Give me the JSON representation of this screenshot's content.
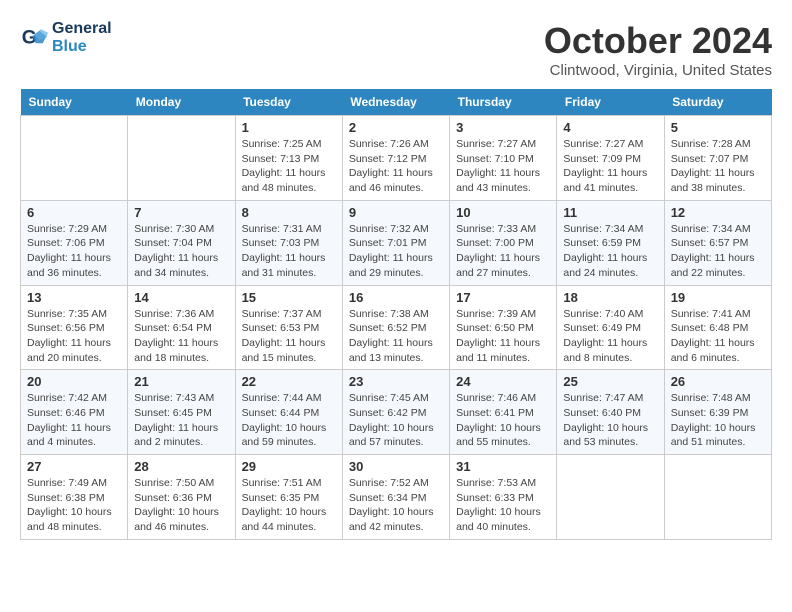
{
  "header": {
    "logo_line1": "General",
    "logo_line2": "Blue",
    "title": "October 2024",
    "subtitle": "Clintwood, Virginia, United States"
  },
  "days": [
    "Sunday",
    "Monday",
    "Tuesday",
    "Wednesday",
    "Thursday",
    "Friday",
    "Saturday"
  ],
  "weeks": [
    [
      {
        "date": "",
        "text": ""
      },
      {
        "date": "",
        "text": ""
      },
      {
        "date": "1",
        "text": "Sunrise: 7:25 AM\nSunset: 7:13 PM\nDaylight: 11 hours and 48 minutes."
      },
      {
        "date": "2",
        "text": "Sunrise: 7:26 AM\nSunset: 7:12 PM\nDaylight: 11 hours and 46 minutes."
      },
      {
        "date": "3",
        "text": "Sunrise: 7:27 AM\nSunset: 7:10 PM\nDaylight: 11 hours and 43 minutes."
      },
      {
        "date": "4",
        "text": "Sunrise: 7:27 AM\nSunset: 7:09 PM\nDaylight: 11 hours and 41 minutes."
      },
      {
        "date": "5",
        "text": "Sunrise: 7:28 AM\nSunset: 7:07 PM\nDaylight: 11 hours and 38 minutes."
      }
    ],
    [
      {
        "date": "6",
        "text": "Sunrise: 7:29 AM\nSunset: 7:06 PM\nDaylight: 11 hours and 36 minutes."
      },
      {
        "date": "7",
        "text": "Sunrise: 7:30 AM\nSunset: 7:04 PM\nDaylight: 11 hours and 34 minutes."
      },
      {
        "date": "8",
        "text": "Sunrise: 7:31 AM\nSunset: 7:03 PM\nDaylight: 11 hours and 31 minutes."
      },
      {
        "date": "9",
        "text": "Sunrise: 7:32 AM\nSunset: 7:01 PM\nDaylight: 11 hours and 29 minutes."
      },
      {
        "date": "10",
        "text": "Sunrise: 7:33 AM\nSunset: 7:00 PM\nDaylight: 11 hours and 27 minutes."
      },
      {
        "date": "11",
        "text": "Sunrise: 7:34 AM\nSunset: 6:59 PM\nDaylight: 11 hours and 24 minutes."
      },
      {
        "date": "12",
        "text": "Sunrise: 7:34 AM\nSunset: 6:57 PM\nDaylight: 11 hours and 22 minutes."
      }
    ],
    [
      {
        "date": "13",
        "text": "Sunrise: 7:35 AM\nSunset: 6:56 PM\nDaylight: 11 hours and 20 minutes."
      },
      {
        "date": "14",
        "text": "Sunrise: 7:36 AM\nSunset: 6:54 PM\nDaylight: 11 hours and 18 minutes."
      },
      {
        "date": "15",
        "text": "Sunrise: 7:37 AM\nSunset: 6:53 PM\nDaylight: 11 hours and 15 minutes."
      },
      {
        "date": "16",
        "text": "Sunrise: 7:38 AM\nSunset: 6:52 PM\nDaylight: 11 hours and 13 minutes."
      },
      {
        "date": "17",
        "text": "Sunrise: 7:39 AM\nSunset: 6:50 PM\nDaylight: 11 hours and 11 minutes."
      },
      {
        "date": "18",
        "text": "Sunrise: 7:40 AM\nSunset: 6:49 PM\nDaylight: 11 hours and 8 minutes."
      },
      {
        "date": "19",
        "text": "Sunrise: 7:41 AM\nSunset: 6:48 PM\nDaylight: 11 hours and 6 minutes."
      }
    ],
    [
      {
        "date": "20",
        "text": "Sunrise: 7:42 AM\nSunset: 6:46 PM\nDaylight: 11 hours and 4 minutes."
      },
      {
        "date": "21",
        "text": "Sunrise: 7:43 AM\nSunset: 6:45 PM\nDaylight: 11 hours and 2 minutes."
      },
      {
        "date": "22",
        "text": "Sunrise: 7:44 AM\nSunset: 6:44 PM\nDaylight: 10 hours and 59 minutes."
      },
      {
        "date": "23",
        "text": "Sunrise: 7:45 AM\nSunset: 6:42 PM\nDaylight: 10 hours and 57 minutes."
      },
      {
        "date": "24",
        "text": "Sunrise: 7:46 AM\nSunset: 6:41 PM\nDaylight: 10 hours and 55 minutes."
      },
      {
        "date": "25",
        "text": "Sunrise: 7:47 AM\nSunset: 6:40 PM\nDaylight: 10 hours and 53 minutes."
      },
      {
        "date": "26",
        "text": "Sunrise: 7:48 AM\nSunset: 6:39 PM\nDaylight: 10 hours and 51 minutes."
      }
    ],
    [
      {
        "date": "27",
        "text": "Sunrise: 7:49 AM\nSunset: 6:38 PM\nDaylight: 10 hours and 48 minutes."
      },
      {
        "date": "28",
        "text": "Sunrise: 7:50 AM\nSunset: 6:36 PM\nDaylight: 10 hours and 46 minutes."
      },
      {
        "date": "29",
        "text": "Sunrise: 7:51 AM\nSunset: 6:35 PM\nDaylight: 10 hours and 44 minutes."
      },
      {
        "date": "30",
        "text": "Sunrise: 7:52 AM\nSunset: 6:34 PM\nDaylight: 10 hours and 42 minutes."
      },
      {
        "date": "31",
        "text": "Sunrise: 7:53 AM\nSunset: 6:33 PM\nDaylight: 10 hours and 40 minutes."
      },
      {
        "date": "",
        "text": ""
      },
      {
        "date": "",
        "text": ""
      }
    ]
  ]
}
